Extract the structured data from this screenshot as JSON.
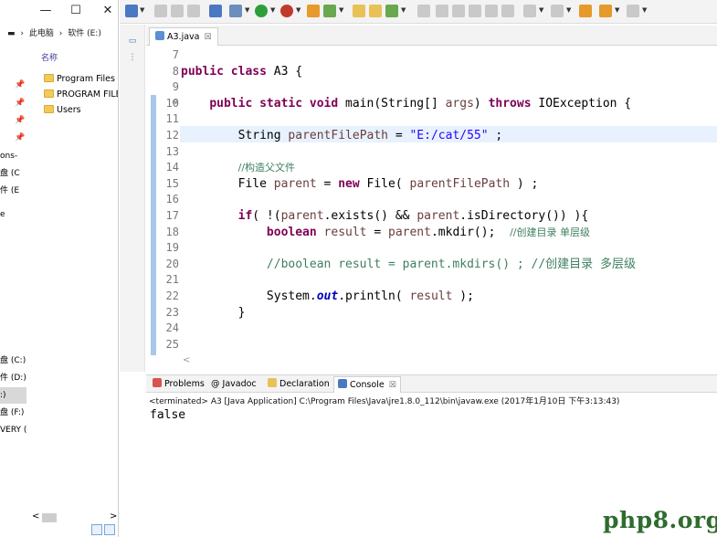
{
  "explorer": {
    "window_controls": {
      "minimize": "—",
      "maximize": "☐",
      "close": "✕"
    },
    "address": {
      "drive_icon": "▬",
      "sep1": "›",
      "this_pc": "此电脑",
      "sep2": "›",
      "drive": "软件 (E:)"
    },
    "column_header": "名称",
    "folders": [
      "Program Files",
      "PROGRAM FILES",
      "Users"
    ],
    "nav_items": [
      "ons-",
      "盘 (C",
      "件 (E",
      "e",
      "盘 (C:)",
      "件 (D:)",
      ":)",
      "盘 (F:)",
      "VERY (C"
    ],
    "scroll_left": "<",
    "scroll_right": ">"
  },
  "editor": {
    "tab_label": "A3.java",
    "tab_close": "☒",
    "line_numbers": [
      "7",
      "8",
      "9",
      "10",
      "11",
      "12",
      "13",
      "14",
      "15",
      "16",
      "17",
      "18",
      "19",
      "20",
      "21",
      "22",
      "23",
      "24",
      "25"
    ],
    "lines": {
      "l8_kw": "public class",
      "l8_rest": " A3 {",
      "l10_kw1": "public static void",
      "l10_mid": " main(String[] ",
      "l10_args": "args",
      "l10_sp": ") ",
      "l10_kw2": "throws",
      "l10_end": " IOException {",
      "l12_a": "String ",
      "l12_var": "parentFilePath",
      "l12_b": " = ",
      "l12_str": "\"E:/cat/55\"",
      "l12_c": " ;",
      "l14_cm": "//构造父文件",
      "l15_a": "File ",
      "l15_var": "parent",
      "l15_b": " = ",
      "l15_kw": "new",
      "l15_c": " File( ",
      "l15_var2": "parentFilePath",
      "l15_d": " ) ;",
      "l17_kw": "if",
      "l17_a": "( !(",
      "l17_var": "parent",
      "l17_b": ".exists() && ",
      "l17_var2": "parent",
      "l17_c": ".isDirectory()) ){",
      "l18_kw": "boolean",
      "l18_a": " ",
      "l18_var": "result",
      "l18_b": " = ",
      "l18_var2": "parent",
      "l18_c": ".mkdir();  ",
      "l18_cm": "//创建目录 单层级",
      "l20_cm": "//boolean result = parent.mkdirs() ; //创建目录 多层级",
      "l22_a": "System.",
      "l22_fld": "out",
      "l22_b": ".println( ",
      "l22_var": "result",
      "l22_c": " );",
      "l23": "}"
    },
    "fold_marker": "⊖",
    "hscroll_arrow": "<"
  },
  "console": {
    "tabs": [
      {
        "label": "Problems",
        "icon": "problems-icon"
      },
      {
        "label": "@ Javadoc",
        "icon": "javadoc-icon"
      },
      {
        "label": "Declaration",
        "icon": "declaration-icon"
      },
      {
        "label": "Console",
        "icon": "console-icon"
      }
    ],
    "close": "☒",
    "status": "<terminated> A3 [Java Application] C:\\Program Files\\Java\\jre1.8.0_112\\bin\\javaw.exe (2017年1月10日 下午3:13:43)",
    "output": "false"
  },
  "watermark": "php8.org",
  "colors": {
    "keyword": "#7f0055",
    "string": "#2a00ff",
    "comment": "#3f7f5f",
    "variable": "#6a3e3e",
    "field": "#0000c0"
  }
}
